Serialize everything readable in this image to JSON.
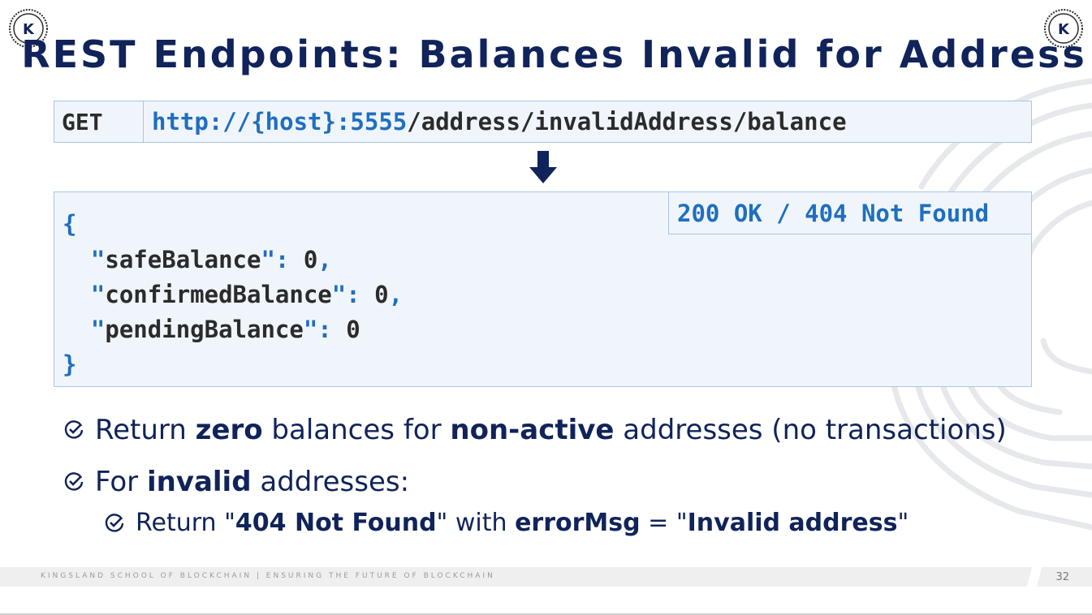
{
  "logo": {
    "letter": "K"
  },
  "title": "REST Endpoints: Balances Invalid for Address",
  "request": {
    "method": "GET",
    "url_host": "http://{host}:5555",
    "url_path": "/address/invalidAddress/balance"
  },
  "response": {
    "status": "200 OK / 404 Not Found",
    "open_brace": "{",
    "close_brace": "}",
    "fields": [
      {
        "key": "safeBalance",
        "value": "0",
        "comma": ","
      },
      {
        "key": "confirmedBalance",
        "value": "0",
        "comma": ","
      },
      {
        "key": "pendingBalance",
        "value": "0",
        "comma": ""
      }
    ]
  },
  "bullets": {
    "b1": {
      "a": "Return ",
      "b": "zero",
      "c": " balances for ",
      "d": "non-active",
      "e": " addresses (no transactions)"
    },
    "b2": {
      "a": "For ",
      "b": "invalid",
      "c": " addresses:"
    },
    "b3": {
      "a": "Return \"",
      "b": "404 Not Found",
      "c": "\" with ",
      "d": "errorMsg",
      "e": " = \"",
      "f": "Invalid address",
      "g": "\""
    }
  },
  "footer": {
    "text": "KINGSLAND SCHOOL OF BLOCKCHAIN | ENSURING THE FUTURE OF BLOCKCHAIN",
    "page": "32"
  },
  "colors": {
    "title": "#10235a",
    "accent": "#1f6fbf",
    "box_border": "#a9c6e3",
    "box_bg": "#f0f5fb"
  }
}
